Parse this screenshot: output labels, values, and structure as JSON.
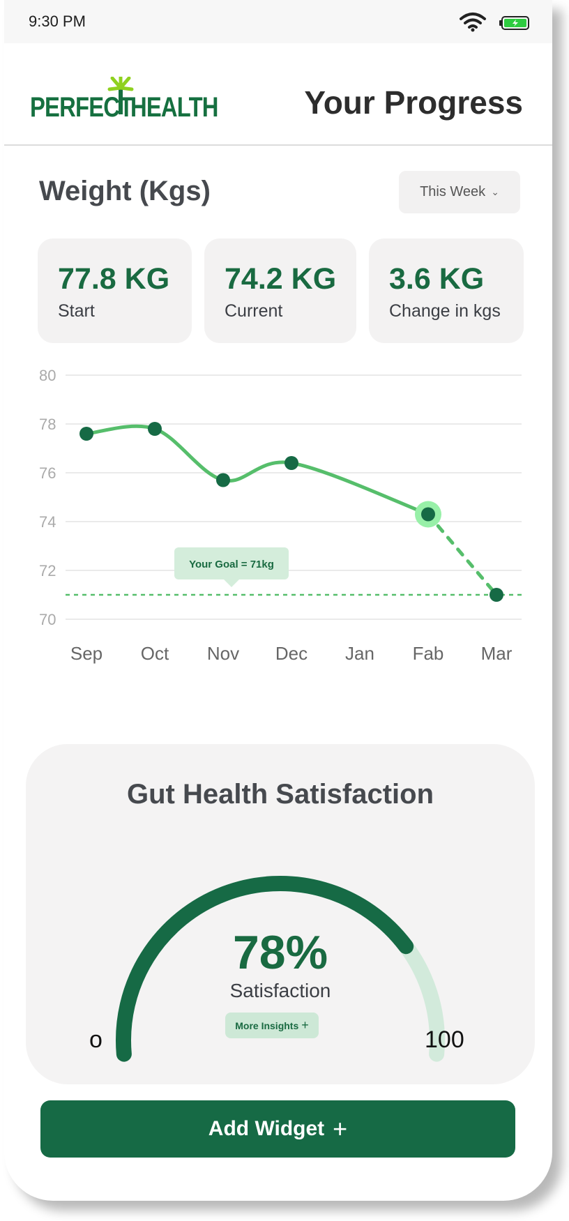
{
  "status_bar": {
    "time": "9:30 PM"
  },
  "header": {
    "logo_left": "PERFECT",
    "logo_right": "HEALTH",
    "title": "Your Progress"
  },
  "weight": {
    "section_title": "Weight (Kgs)",
    "period_dropdown": {
      "selected": "This Week"
    },
    "stats": [
      {
        "value": "77.8 KG",
        "label": "Start"
      },
      {
        "value": "74.2 KG",
        "label": "Current"
      },
      {
        "value": "3.6 KG",
        "label": "Change in kgs"
      }
    ]
  },
  "chart_data": {
    "type": "line",
    "categories": [
      "Sep",
      "Oct",
      "Nov",
      "Dec",
      "Jan",
      "Fab",
      "Mar"
    ],
    "y_ticks": [
      80,
      78,
      76,
      74,
      72,
      70
    ],
    "ylim": [
      70,
      80
    ],
    "grid": true,
    "series": [
      {
        "style": "solid",
        "points": [
          {
            "x": "Sep",
            "y": 77.6
          },
          {
            "x": "Oct",
            "y": 77.8
          },
          {
            "x": "Nov",
            "y": 75.7
          },
          {
            "x": "Dec",
            "y": 76.4
          },
          {
            "x": "Fab",
            "y": 74.3
          }
        ]
      },
      {
        "style": "dashed",
        "points": [
          {
            "x": "Fab",
            "y": 74.3
          },
          {
            "x": "Mar",
            "y": 71.0
          }
        ]
      }
    ],
    "goal": {
      "y": 71,
      "label": "Your Goal = 71kg"
    },
    "colors": {
      "line": "#56be6b",
      "point": "#166a45",
      "highlight": "#98f0a8",
      "grid": "#e3e3e3",
      "tick": "#aaaaaa"
    }
  },
  "gut_health": {
    "title": "Gut Health Satisfaction",
    "value_percent": 78,
    "value_label": "78%",
    "caption": "Satisfaction",
    "insights_button": "More Insights",
    "min_label": "o",
    "max_label": "100",
    "colors": {
      "fill": "#166a45",
      "track": "#d2eadb"
    }
  },
  "actions": {
    "add_widget": "Add Widget"
  },
  "icons": [
    "wifi-icon",
    "battery-icon",
    "logo-star-icon",
    "chevron-down-icon",
    "plus-icon"
  ]
}
